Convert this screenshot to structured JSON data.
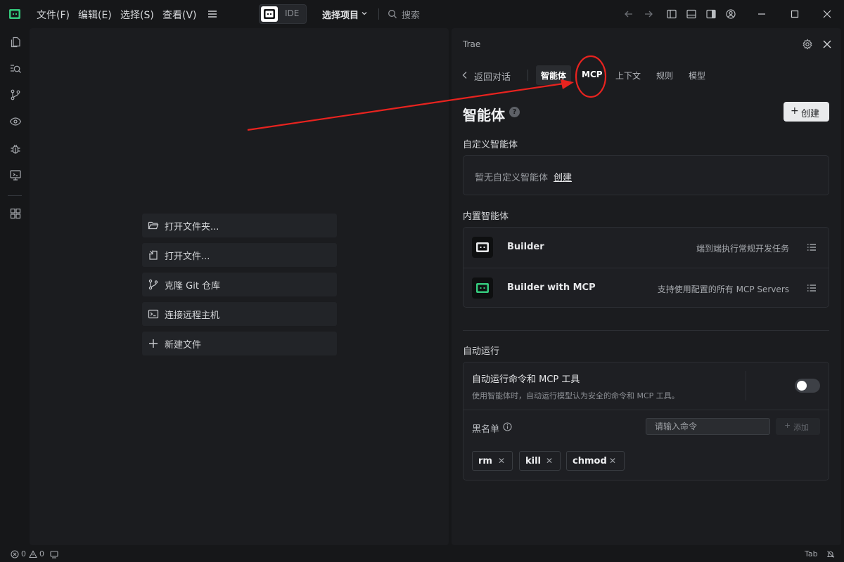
{
  "colors": {
    "accent_green": "#34c77b",
    "annotation_red": "#e8231f",
    "background": "#161719",
    "panel": "#1b1c1f"
  },
  "menu": {
    "items": [
      "文件(F)",
      "编辑(E)",
      "选择(S)",
      "查看(V)"
    ]
  },
  "toolbar": {
    "ide_label": "IDE",
    "project_label": "选择项目",
    "search_label": "搜索"
  },
  "activity_icons": [
    "explorer-icon",
    "search-icon",
    "source-control-icon",
    "preview-icon",
    "debug-icon",
    "remote-icon",
    "extensions-icon"
  ],
  "welcome": {
    "items": [
      {
        "icon": "open-folder-icon",
        "label": "打开文件夹..."
      },
      {
        "icon": "open-file-icon",
        "label": "打开文件..."
      },
      {
        "icon": "git-clone-icon",
        "label": "克隆 Git 仓库"
      },
      {
        "icon": "terminal-icon",
        "label": "连接远程主机"
      },
      {
        "icon": "plus-icon",
        "label": "新建文件"
      }
    ]
  },
  "panel": {
    "title": "Trae",
    "back_label": "返回对话",
    "tabs": [
      "智能体",
      "MCP",
      "上下文",
      "规则",
      "模型"
    ],
    "active_tab": "智能体",
    "heading": "智能体",
    "help_mark": "?",
    "create_label": "创建",
    "custom_agents": {
      "heading": "自定义智能体",
      "empty_text": "暂无自定义智能体",
      "create_link": "创建"
    },
    "builtin_agents": {
      "heading": "内置智能体",
      "items": [
        {
          "name": "Builder",
          "description": "端到端执行常规开发任务"
        },
        {
          "name": "Builder with MCP",
          "description": "支持使用配置的所有 MCP Servers"
        }
      ]
    },
    "auto_run": {
      "heading": "自动运行",
      "title": "自动运行命令和 MCP 工具",
      "description": "使用智能体时，自动运行模型认为安全的命令和 MCP 工具。",
      "enabled": false,
      "blacklist_label": "黑名单",
      "input_placeholder": "请输入命令",
      "add_label": "添加",
      "commands": [
        "rm",
        "kill",
        "chmod"
      ]
    }
  },
  "status": {
    "errors": "0",
    "warnings": "0",
    "tab_label": "Tab"
  }
}
